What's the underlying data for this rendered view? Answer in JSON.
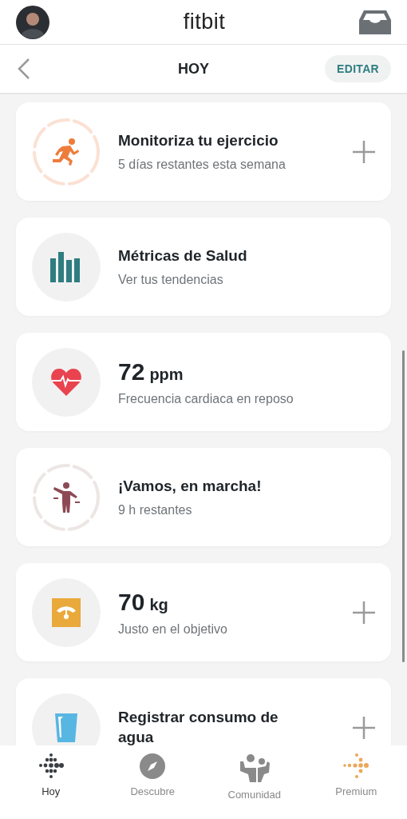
{
  "header": {
    "logo": "fitbit"
  },
  "subheader": {
    "title": "HOY",
    "edit_button": "EDITAR"
  },
  "cards": [
    {
      "kind": "ring",
      "title": "Monitoriza tu ejercicio",
      "subtitle": "5 días restantes esta semana",
      "add": true
    },
    {
      "kind": "circle",
      "title": "Métricas de Salud",
      "subtitle": "Ver tus tendencias",
      "add": false
    },
    {
      "kind": "circle",
      "value": "72",
      "unit": "ppm",
      "subtitle": "Frecuencia cardiaca en reposo",
      "add": false
    },
    {
      "kind": "ring",
      "title": "¡Vamos, en marcha!",
      "subtitle": "9 h restantes",
      "add": false
    },
    {
      "kind": "circle",
      "value": "70",
      "unit": "kg",
      "subtitle": "Justo en el objetivo",
      "add": true
    },
    {
      "kind": "circle",
      "title": "Registrar consumo de agua",
      "add": true
    }
  ],
  "tabs": [
    {
      "label": "Hoy",
      "selected": true
    },
    {
      "label": "Descubre",
      "selected": false
    },
    {
      "label": "Comunidad",
      "selected": false
    },
    {
      "label": "Premium",
      "selected": false
    }
  ]
}
